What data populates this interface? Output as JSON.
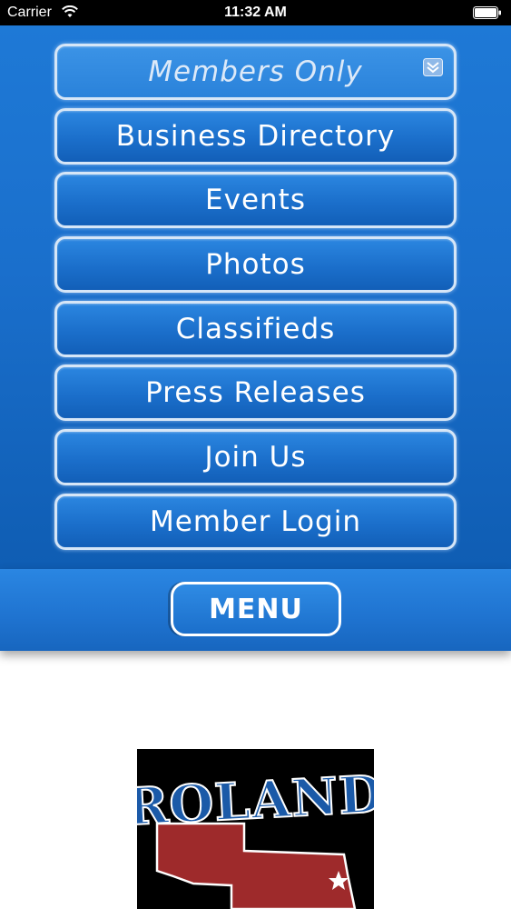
{
  "status_bar": {
    "carrier": "Carrier",
    "time": "11:32 AM",
    "wifi_icon": "wifi-icon",
    "battery_icon": "battery-icon"
  },
  "menu": {
    "header_label": "Members Only",
    "header_icon": "chevron-down-icon",
    "items": [
      {
        "label": "Business Directory"
      },
      {
        "label": "Events"
      },
      {
        "label": "Photos"
      },
      {
        "label": "Classifieds"
      },
      {
        "label": "Press Releases"
      },
      {
        "label": "Join Us"
      },
      {
        "label": "Member Login"
      }
    ],
    "toggle_label": "MENU"
  },
  "logo": {
    "text": "ROLAND",
    "icon": "oklahoma-map-logo"
  },
  "colors": {
    "panel_blue": "#1a6fcc",
    "button_border": "#d6e6f7",
    "logo_state_red": "#9e2a2b",
    "logo_text_blue": "#1b5aa8"
  }
}
